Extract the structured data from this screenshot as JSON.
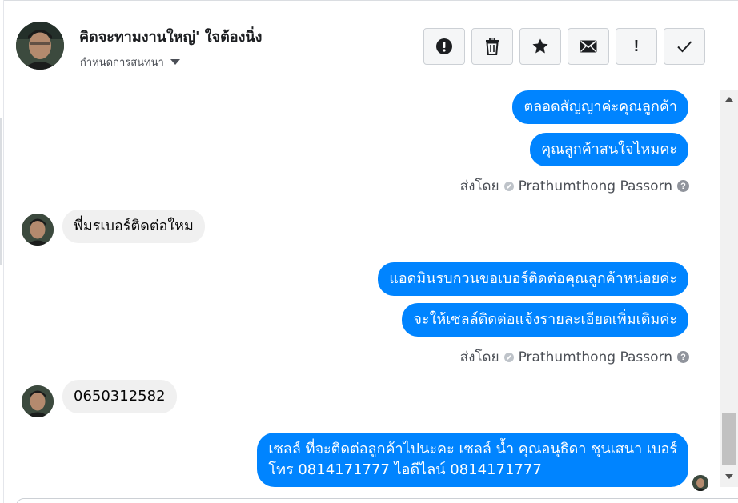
{
  "header": {
    "title": "คิดจะทามงานใหญ่' ใจต้องนิ่ง",
    "subtitle": "กำหนดการสนทนา",
    "actions": [
      {
        "icon": "exclamation-circle-icon"
      },
      {
        "icon": "trash-icon"
      },
      {
        "icon": "star-icon"
      },
      {
        "icon": "envelope-icon"
      },
      {
        "icon": "exclamation-icon",
        "label": "!"
      },
      {
        "icon": "check-icon"
      }
    ]
  },
  "messages": {
    "m1": "ตลอดสัญญาค่ะคุณลูกค้า",
    "m2": "คุณลูกค้าสนใจไหมคะ",
    "sent_by_1": {
      "prefix": "ส่งโดย",
      "name": "Prathumthong Passorn"
    },
    "m3": "พี่มรเบอร์ติดต่อใหม",
    "m4": "แอดมินรบกวนขอเบอร์ติดต่อคุณลูกค้าหน่อยค่ะ",
    "m5": "จะให้เซลล์ติดต่อแจ้งรายละเอียดเพิ่มเติมค่ะ",
    "sent_by_2": {
      "prefix": "ส่งโดย",
      "name": "Prathumthong Passorn"
    },
    "m6": "0650312582",
    "m7_line1": "เซลล์ ที่จะติดต่อลูกค้าไปนะคะ เซลล์ น้ำ คุณอนุธิดา ชุนเสนา เบอร์",
    "m7_line2": "โทร 0814171777 ไอดีไลน์ 0814171777"
  },
  "colors": {
    "outgoing_bubble": "#0084ff",
    "incoming_bubble": "#f0f0f0",
    "text": "#050505"
  }
}
